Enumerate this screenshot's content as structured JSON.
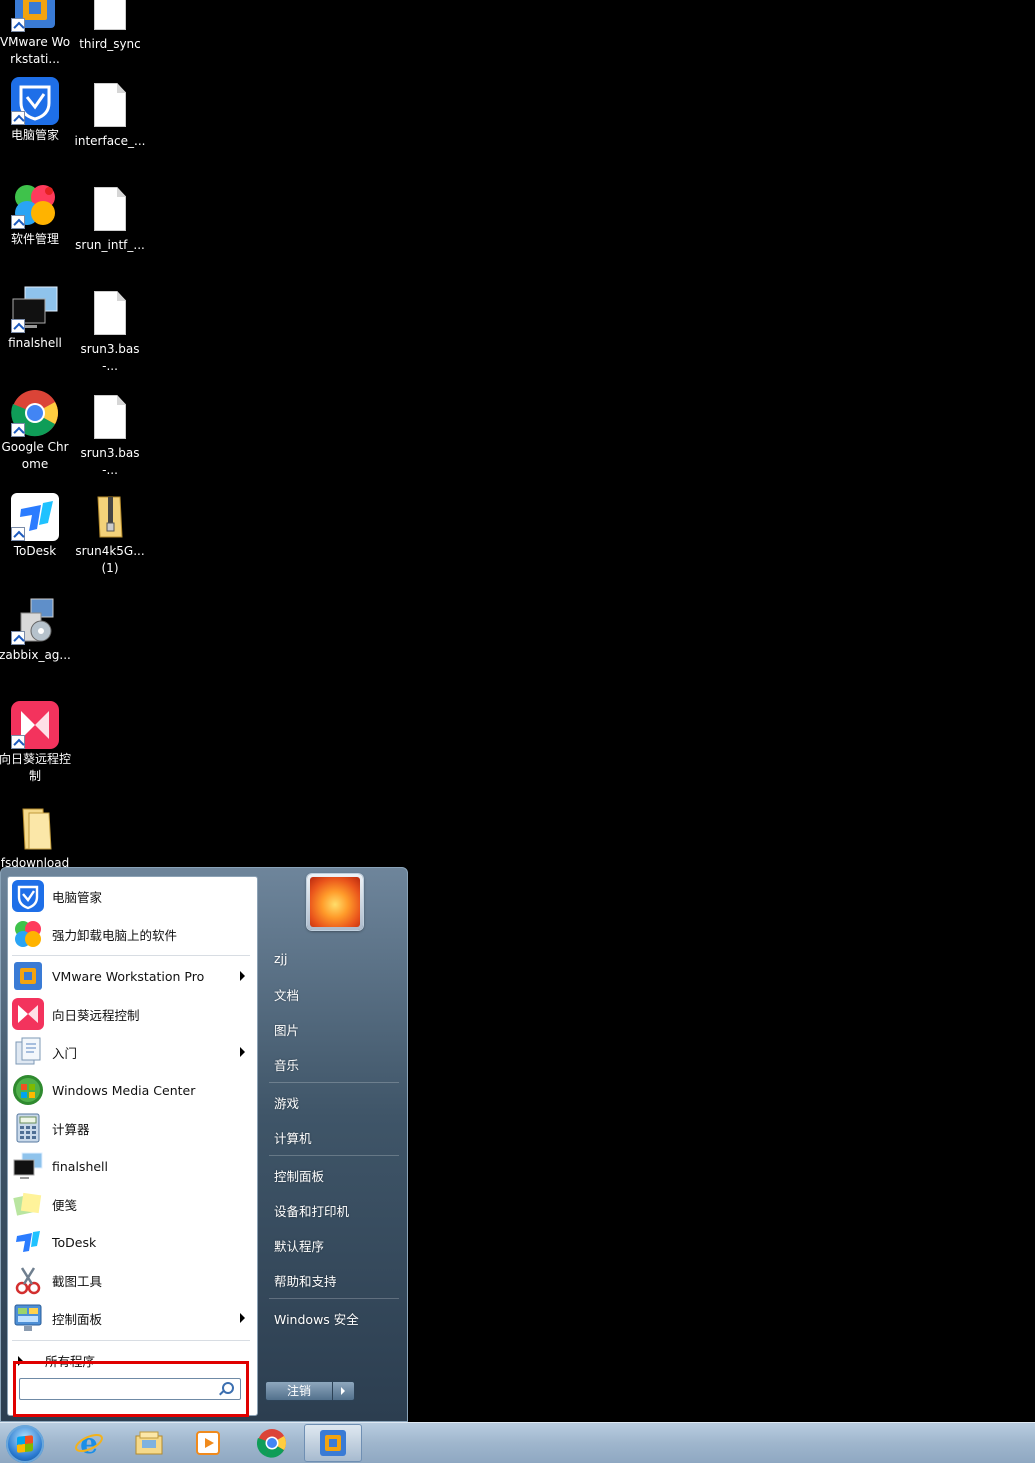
{
  "desktop": {
    "icons": [
      {
        "label": "VMware Workstati...",
        "icon": "vmware-icon"
      },
      {
        "label": "third_sync",
        "icon": "file-icon"
      },
      {
        "label": "电脑管家",
        "icon": "pc-manager-icon"
      },
      {
        "label": "interface_...",
        "icon": "file-icon"
      },
      {
        "label": "软件管理",
        "icon": "software-manager-icon"
      },
      {
        "label": "srun_intf_...",
        "icon": "file-icon"
      },
      {
        "label": "finalshell",
        "icon": "finalshell-icon"
      },
      {
        "label": "srun3.bas-...",
        "icon": "file-icon"
      },
      {
        "label": "Google Chrome",
        "icon": "chrome-icon"
      },
      {
        "label": "srun3.bas-...",
        "icon": "file-icon"
      },
      {
        "label": "ToDesk",
        "icon": "todesk-icon"
      },
      {
        "label": "srun4k5G... (1)",
        "icon": "zip-folder-icon"
      },
      {
        "label": "zabbix_ag...",
        "icon": "installer-icon"
      },
      {
        "label": "向日葵远程控制",
        "icon": "sunlogin-icon"
      },
      {
        "label": "fsdownload",
        "icon": "folder-icon"
      }
    ]
  },
  "start_menu": {
    "programs": [
      {
        "label": "电脑管家",
        "icon": "pc-manager-icon",
        "submenu": false
      },
      {
        "label": "强力卸载电脑上的软件",
        "icon": "software-manager-icon",
        "submenu": false
      },
      {
        "label": "VMware Workstation Pro",
        "icon": "vmware-icon",
        "submenu": true
      },
      {
        "label": "向日葵远程控制",
        "icon": "sunlogin-icon",
        "submenu": false
      },
      {
        "label": "入门",
        "icon": "getting-started-icon",
        "submenu": true
      },
      {
        "label": "Windows Media Center",
        "icon": "media-center-icon",
        "submenu": false
      },
      {
        "label": "计算器",
        "icon": "calculator-icon",
        "submenu": false
      },
      {
        "label": "finalshell",
        "icon": "finalshell-icon",
        "submenu": false
      },
      {
        "label": "便笺",
        "icon": "sticky-notes-icon",
        "submenu": false
      },
      {
        "label": "ToDesk",
        "icon": "todesk-icon",
        "submenu": false
      },
      {
        "label": "截图工具",
        "icon": "snipping-tool-icon",
        "submenu": false
      },
      {
        "label": "控制面板",
        "icon": "control-panel-icon",
        "submenu": true
      }
    ],
    "all_programs": "所有程序",
    "search": {
      "value": "",
      "placeholder": ""
    },
    "right": {
      "user": "zjj",
      "items": [
        "文档",
        "图片",
        "音乐",
        "游戏",
        "计算机",
        "控制面板",
        "设备和打印机",
        "默认程序",
        "帮助和支持",
        "Windows 安全"
      ]
    },
    "shutdown_label": "注销"
  },
  "taskbar": {
    "items": [
      "start-orb",
      "internet-explorer-icon",
      "file-explorer-icon",
      "media-player-icon",
      "chrome-icon",
      "vmware-icon"
    ],
    "active": "vmware-icon"
  },
  "colors": {
    "highlight": "#e00000",
    "taskbar": "#a7bdd3"
  }
}
